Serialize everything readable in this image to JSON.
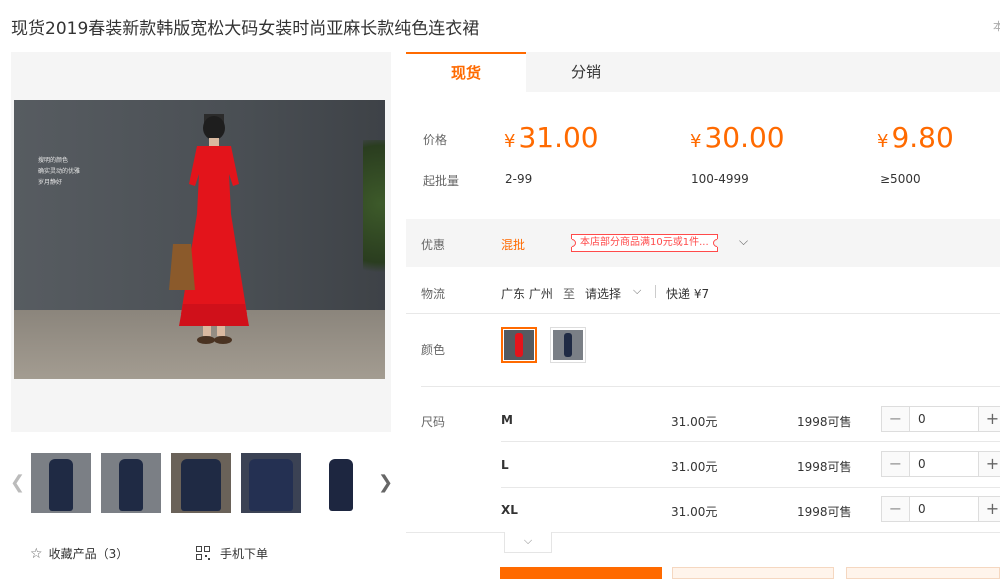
{
  "product": {
    "title": "现货2019春装新款韩版宽松大码女装时尚亚麻长款纯色连衣裙",
    "title_side_text": "本"
  },
  "gallery": {
    "photo_caption_lines": [
      "搜明的颜色",
      "确实灵动的优雅",
      "岁月静好"
    ],
    "prev_icon": "chevron-left-icon",
    "next_icon": "chevron-right-icon"
  },
  "actions": {
    "favorite_label": "收藏产品（3）",
    "mobile_order_label": "手机下单"
  },
  "tabs": [
    "现货",
    "分销"
  ],
  "pricing": {
    "price_label": "价格",
    "moq_label": "起批量",
    "currency": "¥",
    "tiers": [
      {
        "price": "31.00",
        "range": "2-99"
      },
      {
        "price": "30.00",
        "range": "100-4999"
      },
      {
        "price": "9.80",
        "range": "≥5000"
      }
    ]
  },
  "promotion": {
    "label": "优惠",
    "type": "混批",
    "tag": "本店部分商品满10元或1件...",
    "expand_icon": "chevron-down-icon"
  },
  "logistics": {
    "label": "物流",
    "from": "广东 广州",
    "to_word": "至",
    "destination": "请选择",
    "express": "快递 ¥7"
  },
  "color": {
    "label": "颜色",
    "options": [
      "red",
      "navy"
    ]
  },
  "sizes": {
    "label": "尺码",
    "rows": [
      {
        "name": "M",
        "price": "31.00元",
        "stock": "1998可售",
        "qty": "0"
      },
      {
        "name": "L",
        "price": "31.00元",
        "stock": "1998可售",
        "qty": "0"
      },
      {
        "name": "XL",
        "price": "31.00元",
        "stock": "1998可售",
        "qty": "0"
      }
    ],
    "more_icon": "chevron-down-icon"
  },
  "colors": {
    "accent": "#ff6a00",
    "promo_red": "#ff4a4a",
    "panel_bg": "#f5f5f5"
  }
}
